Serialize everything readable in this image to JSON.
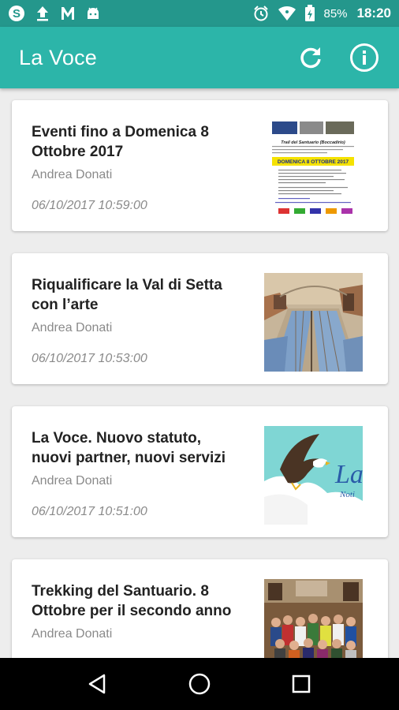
{
  "status_bar": {
    "battery": "85%",
    "time": "18:20",
    "icons_left": [
      "sync-icon",
      "upload-icon",
      "gmail-icon",
      "android-icon"
    ],
    "icons_right": [
      "alarm-icon",
      "wifi-icon",
      "battery-icon"
    ]
  },
  "app_bar": {
    "title": "La Voce",
    "actions": [
      "refresh-icon",
      "info-icon"
    ]
  },
  "articles": [
    {
      "title": "Eventi fino a Domenica 8 Ottobre 2017",
      "author": "Andrea Donati",
      "date": "06/10/2017 10:59:00",
      "thumb_text": "DOMENICA 8 OTTOBRE 2017",
      "thumb_caption": "Trail del Santuario (Boccadirio)"
    },
    {
      "title": "Riqualificare la Val di Setta con l’arte",
      "author": "Andrea Donati",
      "date": "06/10/2017 10:53:00"
    },
    {
      "title": "La Voce. Nuovo statuto, nuovi partner, nuovi servizi",
      "author": "Andrea Donati",
      "date": "06/10/2017 10:51:00",
      "thumb_text": "La",
      "thumb_caption": "Noti"
    },
    {
      "title": "Trekking del Santuario. 8 Ottobre per il secondo anno",
      "author": "Andrea Donati",
      "date": ""
    }
  ],
  "nav_bar": {
    "buttons": [
      "back-icon",
      "home-icon",
      "recents-icon"
    ]
  },
  "colors": {
    "status_bar": "#24978c",
    "app_bar": "#2cb5a9",
    "background": "#ededed"
  }
}
